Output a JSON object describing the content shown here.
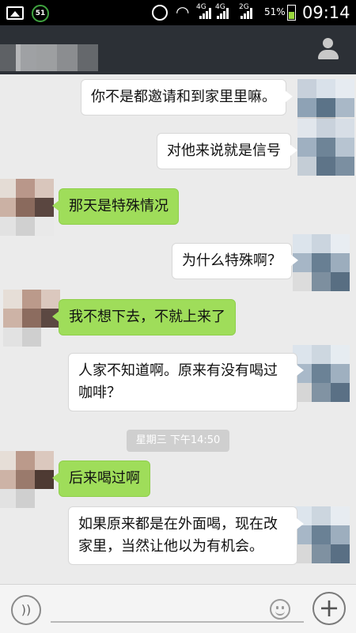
{
  "status_bar": {
    "icons": [
      "gallery-icon",
      "app-notification-icon",
      "alarm-icon",
      "wifi-icon",
      "signal-icon"
    ],
    "app_badge": "51",
    "network_1": "4G",
    "network_2": "4G",
    "network_3": "2G",
    "battery_percent": "51%",
    "battery_level": 0.51,
    "time": "09:14"
  },
  "header": {
    "title": "",
    "profile_icon": "person-icon"
  },
  "messages": [
    {
      "side": "right",
      "text": "你不是都邀请和到家里里嘛。"
    },
    {
      "side": "right",
      "text": "对他来说就是信号"
    },
    {
      "side": "left",
      "text": "那天是特殊情况"
    },
    {
      "side": "right",
      "text": "为什么特殊啊？"
    },
    {
      "side": "left",
      "text": "我不想下去，不就上来了"
    },
    {
      "side": "right",
      "line1": "人家不知道啊。原来有没有喝过",
      "line2": "咖啡？"
    },
    {
      "side": "left",
      "text": "后来喝过啊"
    },
    {
      "side": "right",
      "line1": "如果原来都是在外面喝，现在改",
      "line2": "家里，当然让他以为有机会。"
    }
  ],
  "timestamp": "星期三 下午14:50",
  "input_bar": {
    "voice_icon": "voice-icon",
    "emoji_icon": "emoji-icon",
    "add_symbol": "+",
    "input_value": ""
  },
  "colors": {
    "header_bg": "#2c3036",
    "chat_bg": "#ebebeb",
    "sent_bubble": "#ffffff",
    "received_bubble": "#9fdd5a"
  }
}
